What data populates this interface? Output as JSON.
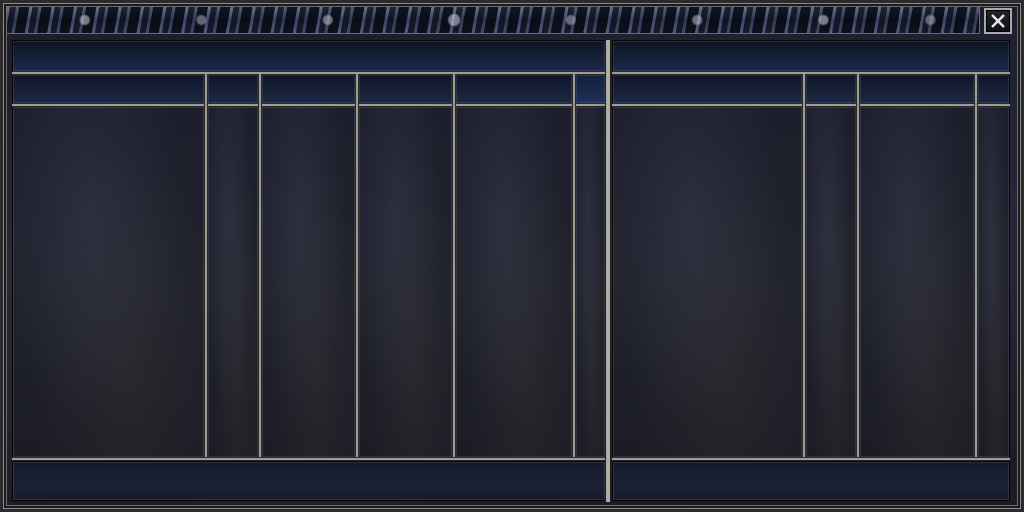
{
  "window": {
    "title": "",
    "close_icon": "close-icon"
  },
  "left_panel": {
    "header": "",
    "columns": [
      "",
      "",
      "",
      "",
      "",
      ""
    ],
    "footer": ""
  },
  "right_panel": {
    "header": "",
    "columns": [
      "",
      "",
      "",
      ""
    ],
    "footer": ""
  },
  "colors": {
    "frame_silver": "#9d9b95",
    "header_blue": "#1a2848",
    "body_dark": "#1e202b"
  }
}
